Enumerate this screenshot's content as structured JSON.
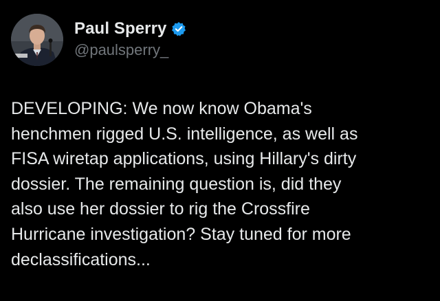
{
  "colors": {
    "background": "#000000",
    "text": "#e7e9ea",
    "secondary_text": "#71767b",
    "verified_blue": "#1d9bf0"
  },
  "author": {
    "display_name": "Paul Sperry",
    "handle": "@paulsperry_",
    "verified": true,
    "avatar_icon": "profile-photo"
  },
  "tweet": {
    "lines": [
      "DEVELOPING: We now know Obama's",
      "henchmen rigged U.S. intelligence, as well as",
      "FISA wiretap applications, using Hillary's dirty",
      "dossier. The remaining question is, did they",
      "also use her dossier to rig the Crossfire",
      "Hurricane investigation? Stay tuned for more",
      "declassifications..."
    ]
  }
}
